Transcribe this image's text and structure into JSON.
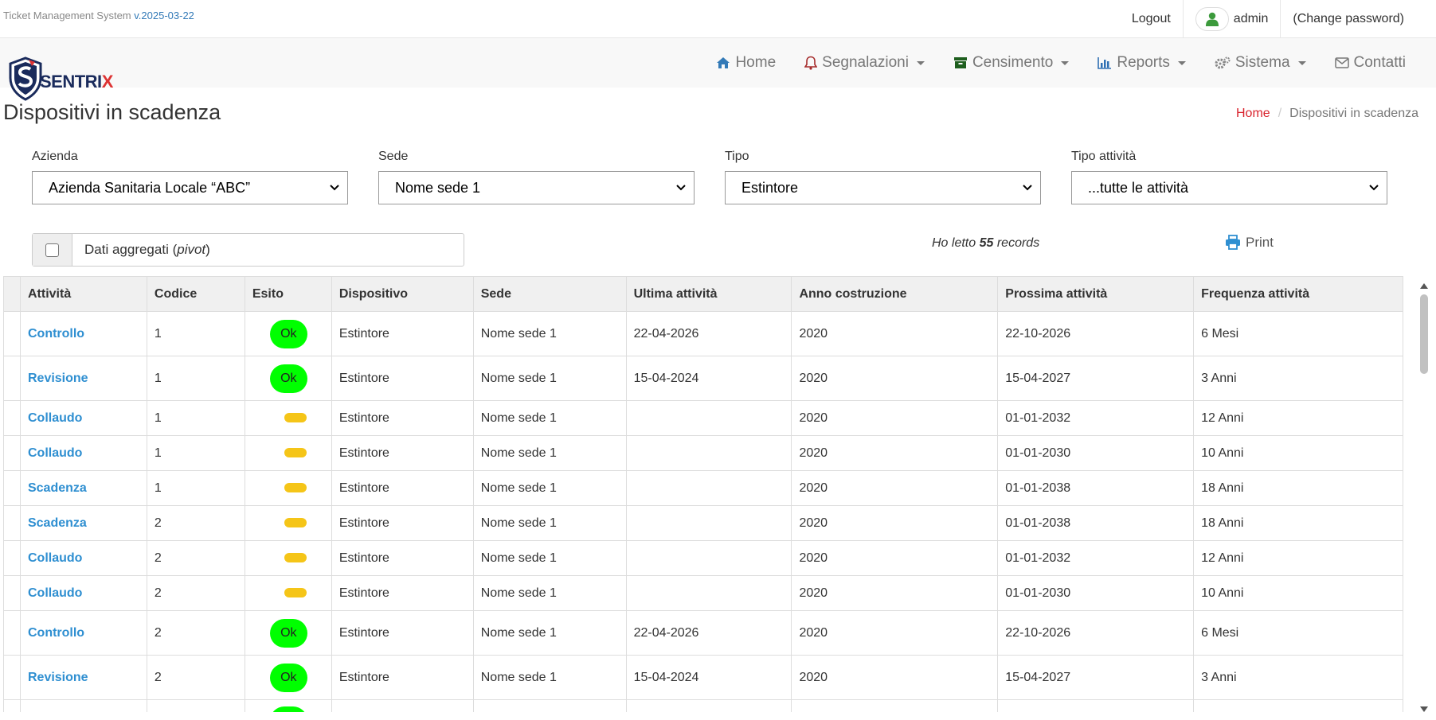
{
  "topbar": {
    "app_name": "Ticket Management System",
    "version": "v.2025-03-22",
    "logout": "Logout",
    "user": "admin",
    "change_password": "(Change password)"
  },
  "logo": {
    "text_main": "SENTRI",
    "text_accent": "X"
  },
  "nav": {
    "home": "Home",
    "segnalazioni": "Segnalazioni",
    "censimento": "Censimento",
    "reports": "Reports",
    "sistema": "Sistema",
    "contatti": "Contatti"
  },
  "page": {
    "title": "Dispositivi in scadenza"
  },
  "breadcrumb": {
    "home": "Home",
    "current": "Dispositivi in scadenza"
  },
  "filters": {
    "azienda": {
      "label": "Azienda",
      "value": "Azienda Sanitaria Locale “ABC”"
    },
    "sede": {
      "label": "Sede",
      "value": "Nome sede 1"
    },
    "tipo": {
      "label": "Tipo",
      "value": "Estintore"
    },
    "tipo_attivita": {
      "label": "Tipo attività",
      "value": "...tutte le attività"
    }
  },
  "pivot": {
    "label_prefix": "Dati aggregati (",
    "label_em": "pivot",
    "label_suffix": ")"
  },
  "records": {
    "prefix": "Ho letto ",
    "count": "55",
    "suffix": " records"
  },
  "print": {
    "label": "Print"
  },
  "colors": {
    "accent": "#2f8fd1",
    "ok": "#00ff00",
    "pending": "#f5c518",
    "brand_red": "#d9232d"
  },
  "table": {
    "headers": [
      "Attività",
      "Codice",
      "Esito",
      "Dispositivo",
      "Sede",
      "Ultima attività",
      "Anno costruzione",
      "Prossima attività",
      "Frequenza attività"
    ],
    "rows": [
      {
        "attivita": "Controllo",
        "codice": "1",
        "esito": "ok",
        "esito_label": "Ok",
        "dispositivo": "Estintore",
        "sede": "Nome sede 1",
        "ultima": "22-04-2026",
        "anno": "2020",
        "prossima": "22-10-2026",
        "frequenza": "6 Mesi"
      },
      {
        "attivita": "Revisione",
        "codice": "1",
        "esito": "ok",
        "esito_label": "Ok",
        "dispositivo": "Estintore",
        "sede": "Nome sede 1",
        "ultima": "15-04-2024",
        "anno": "2020",
        "prossima": "15-04-2027",
        "frequenza": "3 Anni"
      },
      {
        "attivita": "Collaudo",
        "codice": "1",
        "esito": "pending",
        "esito_label": "",
        "dispositivo": "Estintore",
        "sede": "Nome sede 1",
        "ultima": "",
        "anno": "2020",
        "prossima": "01-01-2032",
        "frequenza": "12 Anni"
      },
      {
        "attivita": "Collaudo",
        "codice": "1",
        "esito": "pending",
        "esito_label": "",
        "dispositivo": "Estintore",
        "sede": "Nome sede 1",
        "ultima": "",
        "anno": "2020",
        "prossima": "01-01-2030",
        "frequenza": "10 Anni"
      },
      {
        "attivita": "Scadenza",
        "codice": "1",
        "esito": "pending",
        "esito_label": "",
        "dispositivo": "Estintore",
        "sede": "Nome sede 1",
        "ultima": "",
        "anno": "2020",
        "prossima": "01-01-2038",
        "frequenza": "18 Anni"
      },
      {
        "attivita": "Scadenza",
        "codice": "2",
        "esito": "pending",
        "esito_label": "",
        "dispositivo": "Estintore",
        "sede": "Nome sede 1",
        "ultima": "",
        "anno": "2020",
        "prossima": "01-01-2038",
        "frequenza": "18 Anni"
      },
      {
        "attivita": "Collaudo",
        "codice": "2",
        "esito": "pending",
        "esito_label": "",
        "dispositivo": "Estintore",
        "sede": "Nome sede 1",
        "ultima": "",
        "anno": "2020",
        "prossima": "01-01-2032",
        "frequenza": "12 Anni"
      },
      {
        "attivita": "Collaudo",
        "codice": "2",
        "esito": "pending",
        "esito_label": "",
        "dispositivo": "Estintore",
        "sede": "Nome sede 1",
        "ultima": "",
        "anno": "2020",
        "prossima": "01-01-2030",
        "frequenza": "10 Anni"
      },
      {
        "attivita": "Controllo",
        "codice": "2",
        "esito": "ok",
        "esito_label": "Ok",
        "dispositivo": "Estintore",
        "sede": "Nome sede 1",
        "ultima": "22-04-2026",
        "anno": "2020",
        "prossima": "22-10-2026",
        "frequenza": "6 Mesi"
      },
      {
        "attivita": "Revisione",
        "codice": "2",
        "esito": "ok",
        "esito_label": "Ok",
        "dispositivo": "Estintore",
        "sede": "Nome sede 1",
        "ultima": "15-04-2024",
        "anno": "2020",
        "prossima": "15-04-2027",
        "frequenza": "3 Anni"
      },
      {
        "attivita": "",
        "codice": "",
        "esito": "ok",
        "esito_label": "",
        "dispositivo": "",
        "sede": "",
        "ultima": "",
        "anno": "",
        "prossima": "",
        "frequenza": ""
      }
    ]
  }
}
